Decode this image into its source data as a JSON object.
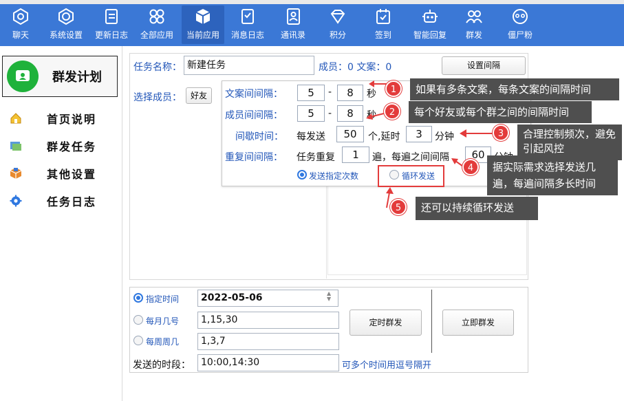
{
  "toolbar": {
    "items": [
      {
        "label": "聊天",
        "icon": "chat-icon"
      },
      {
        "label": "系统设置",
        "icon": "settings-icon"
      },
      {
        "label": "更新日志",
        "icon": "changelog-icon"
      },
      {
        "label": "全部应用",
        "icon": "apps-icon"
      },
      {
        "label": "当前应用",
        "icon": "current-app-icon"
      },
      {
        "label": "消息日志",
        "icon": "message-log-icon"
      },
      {
        "label": "通讯录",
        "icon": "contacts-icon"
      },
      {
        "label": "积分",
        "icon": "points-icon"
      },
      {
        "label": "签到",
        "icon": "checkin-icon"
      },
      {
        "label": "智能回复",
        "icon": "robot-icon"
      },
      {
        "label": "群发",
        "icon": "group-send-icon"
      },
      {
        "label": "僵尸粉",
        "icon": "zombie-fans-icon"
      }
    ],
    "active_index": 4
  },
  "sidebar": {
    "plan_title": "群发计划",
    "items": [
      {
        "label": "首页说明",
        "icon": "home-icon"
      },
      {
        "label": "群发任务",
        "icon": "task-icon"
      },
      {
        "label": "其他设置",
        "icon": "box-icon"
      },
      {
        "label": "任务日志",
        "icon": "log-gear-icon"
      }
    ]
  },
  "task": {
    "name_label": "任务名称：",
    "name_value": "新建任务",
    "members_label": "成员：0 文案：0",
    "interval_button": "设置间隔",
    "select_members_label": "选择成员：",
    "friend_button": "好友"
  },
  "interval": {
    "copy_label": "文案间间隔：",
    "copy_from": "5",
    "copy_to": "8",
    "member_label": "成员间间隔：",
    "member_from": "5",
    "member_to": "8",
    "dash": "-",
    "sec_unit": "秒",
    "pause_label": "间歇时间：",
    "pause_prefix": "每发送",
    "pause_count": "50",
    "pause_mid": "个,延时",
    "pause_minutes": "3",
    "min_unit": "分钟",
    "repeat_label": "重复间间隔：",
    "repeat_prefix": "任务重复",
    "repeat_count": "1",
    "repeat_mid": "遍，每遍之间间隔",
    "repeat_minutes": "60",
    "repeat_unit": "分钟",
    "opt_count": "发送指定次数",
    "opt_loop": "循环发送"
  },
  "schedule": {
    "opt_time": "指定时间",
    "date_value": "2022-05-06",
    "opt_monthly": "每月几号",
    "monthly_value": "1,15,30",
    "opt_weekly": "每周周几",
    "weekly_value": "1,3,7",
    "period_label": "发送的时段：",
    "period_value": "10:00,14:30",
    "period_hint": "可多个时间用逗号隔开",
    "timed_button": "定时群发",
    "now_button": "立即群发"
  },
  "annotations": [
    {
      "num": "1",
      "text": "如果有多条文案，每条文案的间隔时间"
    },
    {
      "num": "2",
      "text": "每个好友或每个群之间的间隔时间"
    },
    {
      "num": "3",
      "text": "合理控制频次，避免引起风控"
    },
    {
      "num": "4",
      "text": "据实际需求选择发送几遍，每遍间隔多长时间"
    },
    {
      "num": "5",
      "text": "还可以持续循环发送"
    }
  ],
  "colors": {
    "toolbar": "#3b78d6",
    "accent_blue": "#2256b8",
    "annotation_bg": "#4f4f4f",
    "badge_red": "#e33b3b",
    "plan_green": "#1fb23b"
  }
}
